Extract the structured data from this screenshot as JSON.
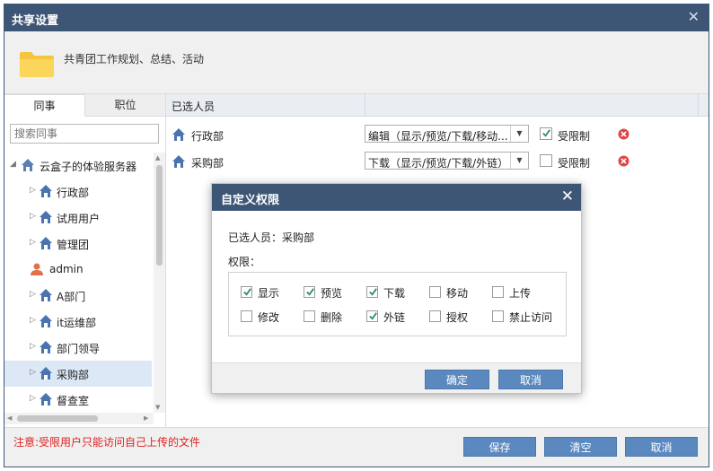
{
  "window": {
    "title": "共享设置"
  },
  "header": {
    "folder_name": "共青团工作规划、总结、活动"
  },
  "left": {
    "tabs": [
      {
        "label": "同事",
        "active": true
      },
      {
        "label": "职位",
        "active": false
      }
    ],
    "search_placeholder": "搜索同事",
    "tree": {
      "root": "云盒子的体验服务器",
      "items": [
        {
          "label": "行政部",
          "type": "group",
          "selected": false
        },
        {
          "label": "试用用户",
          "type": "group",
          "selected": false
        },
        {
          "label": "管理团",
          "type": "group",
          "selected": false
        },
        {
          "label": "admin",
          "type": "user",
          "selected": false
        },
        {
          "label": "A部门",
          "type": "group",
          "selected": false
        },
        {
          "label": "it运维部",
          "type": "group",
          "selected": false
        },
        {
          "label": "部门领导",
          "type": "group",
          "selected": false
        },
        {
          "label": "采购部",
          "type": "group",
          "selected": true
        },
        {
          "label": "督查室",
          "type": "group",
          "selected": false
        }
      ]
    }
  },
  "right": {
    "column_header": "已选人员",
    "rows": [
      {
        "name": "行政部",
        "permission": "编辑（显示/预览/下载/移动...",
        "restricted": true,
        "restricted_label": "受限制"
      },
      {
        "name": "采购部",
        "permission": "下载（显示/预览/下载/外链）",
        "restricted": false,
        "restricted_label": "受限制"
      }
    ]
  },
  "footer": {
    "note": "注意:受限用户只能访问自己上传的文件",
    "save": "保存",
    "clear": "清空",
    "cancel": "取消"
  },
  "modal": {
    "title": "自定义权限",
    "selected_line": "已选人员：采购部",
    "perm_label": "权限：",
    "permissions": [
      {
        "label": "显示",
        "checked": true
      },
      {
        "label": "预览",
        "checked": true
      },
      {
        "label": "下载",
        "checked": true
      },
      {
        "label": "移动",
        "checked": false
      },
      {
        "label": "上传",
        "checked": false
      },
      {
        "label": "修改",
        "checked": false
      },
      {
        "label": "删除",
        "checked": false
      },
      {
        "label": "外链",
        "checked": true
      },
      {
        "label": "授权",
        "checked": false
      },
      {
        "label": "禁止访问",
        "checked": false
      }
    ],
    "ok": "确定",
    "cancel": "取消"
  },
  "colors": {
    "titlebar": "#3e5676",
    "button": "#5b89bf",
    "check": "#2d8a7a",
    "delete": "#e04646",
    "note": "#e02020"
  }
}
